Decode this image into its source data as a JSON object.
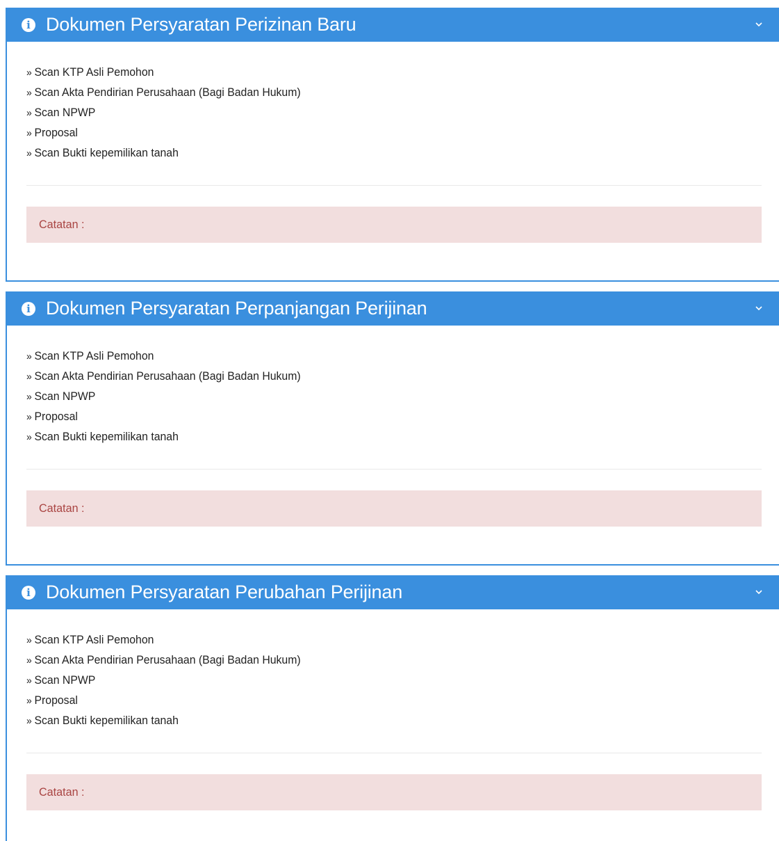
{
  "panels": [
    {
      "title": "Dokumen Persyaratan Perizinan Baru",
      "icon": "info-circle-icon",
      "toggle_icon": "chevron-down-icon",
      "items": [
        "Scan KTP Asli Pemohon",
        "Scan Akta Pendirian Perusahaan (Bagi Badan Hukum)",
        "Scan NPWP",
        "Proposal",
        "Scan Bukti kepemilikan tanah"
      ],
      "note_label": "Catatan :"
    },
    {
      "title": "Dokumen Persyaratan Perpanjangan Perijinan",
      "icon": "info-circle-icon",
      "toggle_icon": "chevron-down-icon",
      "items": [
        "Scan KTP Asli Pemohon",
        "Scan Akta Pendirian Perusahaan (Bagi Badan Hukum)",
        "Scan NPWP",
        "Proposal",
        "Scan Bukti kepemilikan tanah"
      ],
      "note_label": "Catatan :"
    },
    {
      "title": "Dokumen Persyaratan Perubahan Perijinan",
      "icon": "info-circle-icon",
      "toggle_icon": "chevron-down-icon",
      "items": [
        "Scan KTP Asli Pemohon",
        "Scan Akta Pendirian Perusahaan (Bagi Badan Hukum)",
        "Scan NPWP",
        "Proposal",
        "Scan Bukti kepemilikan tanah"
      ],
      "note_label": "Catatan :"
    }
  ],
  "bullet": "»",
  "colors": {
    "header": "#3a8fde",
    "header_text": "#ffffff",
    "note_background": "#f2dede",
    "note_text": "#a94442"
  }
}
